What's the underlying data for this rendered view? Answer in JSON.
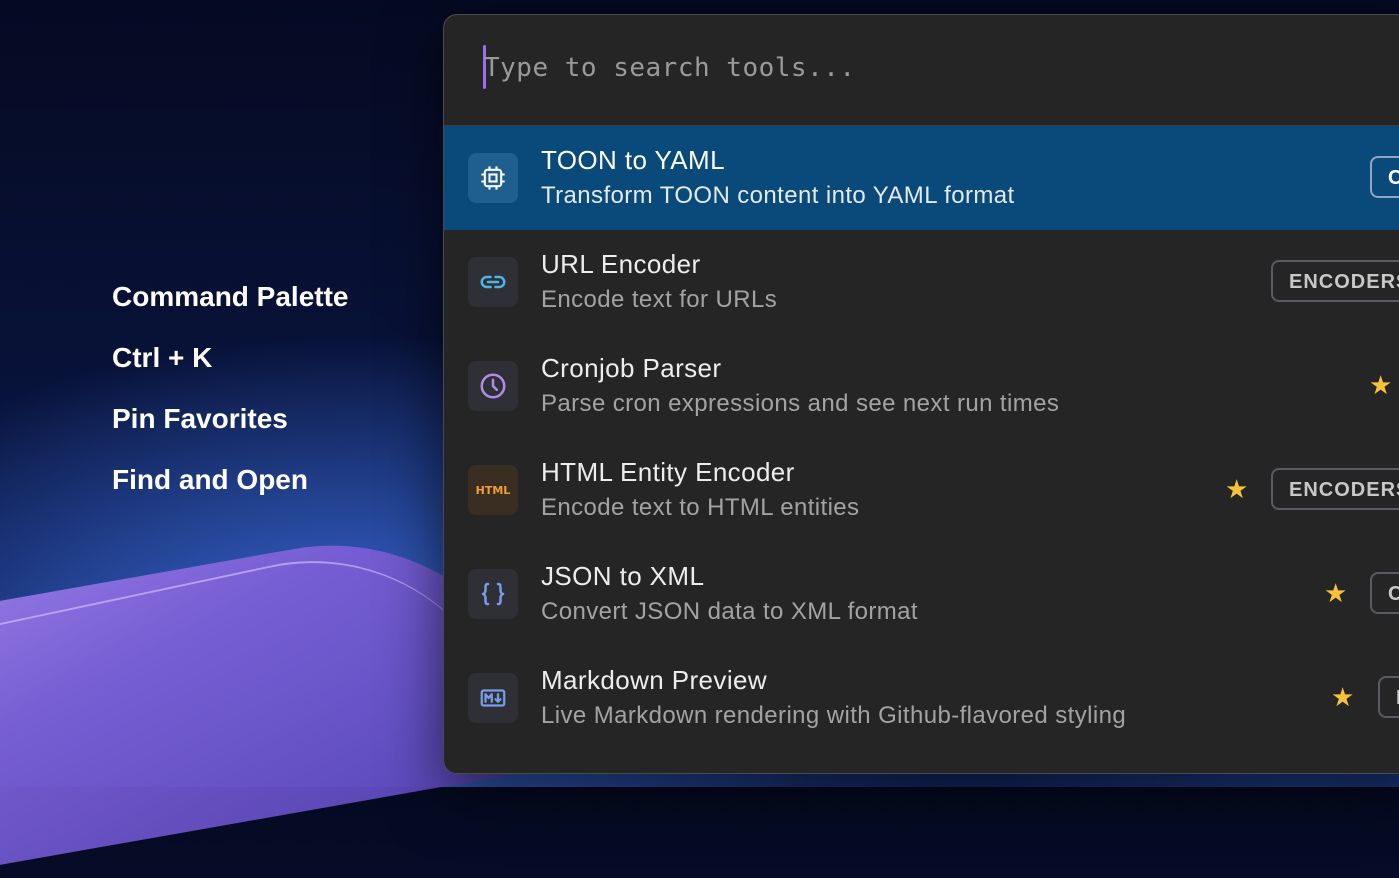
{
  "features": [
    "Command Palette",
    "Ctrl + K",
    "Pin Favorites",
    "Find and Open"
  ],
  "search": {
    "placeholder": "Type to search tools..."
  },
  "tools": [
    {
      "title": "TOON to YAML",
      "description": "Transform TOON content into YAML format",
      "icon": "chip-icon",
      "starred": false,
      "badge": "C",
      "selected": true
    },
    {
      "title": "URL Encoder",
      "description": "Encode text for URLs",
      "icon": "link-icon",
      "starred": false,
      "badge": "ENCODERS",
      "selected": false
    },
    {
      "title": "Cronjob Parser",
      "description": "Parse cron expressions and see next run times",
      "icon": "clock-icon",
      "starred": true,
      "badge": "",
      "selected": false
    },
    {
      "title": "HTML Entity Encoder",
      "description": "Encode text to HTML entities",
      "icon": "html-icon",
      "icon_text": "HTML",
      "starred": true,
      "badge": "ENCODERS",
      "selected": false
    },
    {
      "title": "JSON to XML",
      "description": "Convert JSON data to XML format",
      "icon": "braces-icon",
      "starred": true,
      "badge": "C",
      "selected": false
    },
    {
      "title": "Markdown Preview",
      "description": "Live Markdown rendering with Github-flavored styling",
      "icon": "markdown-icon",
      "starred": true,
      "badge": "I",
      "selected": false
    }
  ],
  "colors": {
    "selected_row": "#0a4a7a",
    "star": "#f5c23a",
    "caret": "#9b6cf0"
  }
}
